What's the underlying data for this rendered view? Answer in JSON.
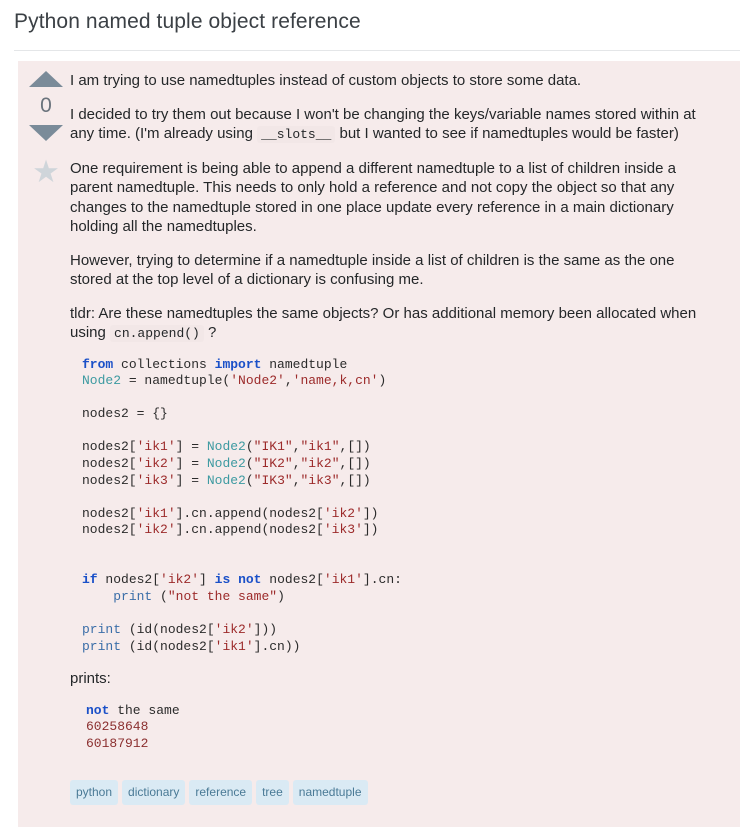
{
  "question": {
    "title": "Python named tuple object reference",
    "vote": {
      "score": "0",
      "up_icon": "triangle-up-icon",
      "down_icon": "triangle-down-icon",
      "favorite_icon": "star-icon",
      "favorite_glyph": "★"
    },
    "body": {
      "p1": "I am trying to use namedtuples instead of custom objects to store some data.",
      "p2_before": "I decided to try them out because I won't be changing the keys/variable names stored within at any time. (I'm already using ",
      "p2_code": "__slots__",
      "p2_after": " but I wanted to see if namedtuples would be faster)",
      "p3": "One requirement is being able to append a different namedtuple to a list of children inside a parent namedtuple. This needs to only hold a reference and not copy the object so that any changes to the namedtuple stored in one place update every reference in a main dictionary holding all the namedtuples.",
      "p4": "However, trying to determine if a namedtuple inside a list of children is the same as the one stored at the top level of a dictionary is confusing me.",
      "p5_before": "tldr: Are these namedtuples the same objects? Or has additional memory been allocated when using ",
      "p5_code": "cn.append()",
      "p5_after": " ?",
      "prints_label": "prints:"
    },
    "code_block": {
      "lines": [
        [
          {
            "t": "from",
            "c": "k"
          },
          {
            "t": " collections ",
            "c": ""
          },
          {
            "t": "import",
            "c": "k"
          },
          {
            "t": " namedtuple",
            "c": ""
          }
        ],
        [
          {
            "t": "Node2",
            "c": "nc"
          },
          {
            "t": " = namedtuple(",
            "c": ""
          },
          {
            "t": "'Node2'",
            "c": "s"
          },
          {
            "t": ",",
            "c": ""
          },
          {
            "t": "'name,k,cn'",
            "c": "s"
          },
          {
            "t": ")",
            "c": ""
          }
        ],
        [],
        [
          {
            "t": "nodes2 = {}",
            "c": ""
          }
        ],
        [],
        [
          {
            "t": "nodes2[",
            "c": ""
          },
          {
            "t": "'ik1'",
            "c": "s"
          },
          {
            "t": "] = ",
            "c": ""
          },
          {
            "t": "Node2",
            "c": "nc"
          },
          {
            "t": "(",
            "c": ""
          },
          {
            "t": "\"IK1\"",
            "c": "s"
          },
          {
            "t": ",",
            "c": ""
          },
          {
            "t": "\"ik1\"",
            "c": "s"
          },
          {
            "t": ",[])",
            "c": ""
          }
        ],
        [
          {
            "t": "nodes2[",
            "c": ""
          },
          {
            "t": "'ik2'",
            "c": "s"
          },
          {
            "t": "] = ",
            "c": ""
          },
          {
            "t": "Node2",
            "c": "nc"
          },
          {
            "t": "(",
            "c": ""
          },
          {
            "t": "\"IK2\"",
            "c": "s"
          },
          {
            "t": ",",
            "c": ""
          },
          {
            "t": "\"ik2\"",
            "c": "s"
          },
          {
            "t": ",[])",
            "c": ""
          }
        ],
        [
          {
            "t": "nodes2[",
            "c": ""
          },
          {
            "t": "'ik3'",
            "c": "s"
          },
          {
            "t": "] = ",
            "c": ""
          },
          {
            "t": "Node2",
            "c": "nc"
          },
          {
            "t": "(",
            "c": ""
          },
          {
            "t": "\"IK3\"",
            "c": "s"
          },
          {
            "t": ",",
            "c": ""
          },
          {
            "t": "\"ik3\"",
            "c": "s"
          },
          {
            "t": ",[])",
            "c": ""
          }
        ],
        [],
        [
          {
            "t": "nodes2[",
            "c": ""
          },
          {
            "t": "'ik1'",
            "c": "s"
          },
          {
            "t": "].cn.append(nodes2[",
            "c": ""
          },
          {
            "t": "'ik2'",
            "c": "s"
          },
          {
            "t": "])",
            "c": ""
          }
        ],
        [
          {
            "t": "nodes2[",
            "c": ""
          },
          {
            "t": "'ik2'",
            "c": "s"
          },
          {
            "t": "].cn.append(nodes2[",
            "c": ""
          },
          {
            "t": "'ik3'",
            "c": "s"
          },
          {
            "t": "])",
            "c": ""
          }
        ],
        [],
        [],
        [
          {
            "t": "if",
            "c": "k"
          },
          {
            "t": " nodes2[",
            "c": ""
          },
          {
            "t": "'ik2'",
            "c": "s"
          },
          {
            "t": "] ",
            "c": ""
          },
          {
            "t": "is",
            "c": "k"
          },
          {
            "t": " ",
            "c": ""
          },
          {
            "t": "not",
            "c": "k"
          },
          {
            "t": " nodes2[",
            "c": ""
          },
          {
            "t": "'ik1'",
            "c": "s"
          },
          {
            "t": "].cn:",
            "c": ""
          }
        ],
        [
          {
            "t": "    ",
            "c": ""
          },
          {
            "t": "print",
            "c": "nf"
          },
          {
            "t": " (",
            "c": ""
          },
          {
            "t": "\"not the same\"",
            "c": "s"
          },
          {
            "t": ")",
            "c": ""
          }
        ],
        [],
        [
          {
            "t": "print",
            "c": "nf"
          },
          {
            "t": " (id(nodes2[",
            "c": ""
          },
          {
            "t": "'ik2'",
            "c": "s"
          },
          {
            "t": "]))",
            "c": ""
          }
        ],
        [
          {
            "t": "print",
            "c": "nf"
          },
          {
            "t": " (id(nodes2[",
            "c": ""
          },
          {
            "t": "'ik1'",
            "c": "s"
          },
          {
            "t": "].cn))",
            "c": ""
          }
        ]
      ]
    },
    "output_block": {
      "lines": [
        [
          {
            "t": "not",
            "c": "k"
          },
          {
            "t": " the same",
            "c": ""
          }
        ],
        [
          {
            "t": "60258648",
            "c": "m"
          }
        ],
        [
          {
            "t": "60187912",
            "c": "m"
          }
        ]
      ]
    },
    "tags": [
      "python",
      "dictionary",
      "reference",
      "tree",
      "namedtuple"
    ]
  }
}
